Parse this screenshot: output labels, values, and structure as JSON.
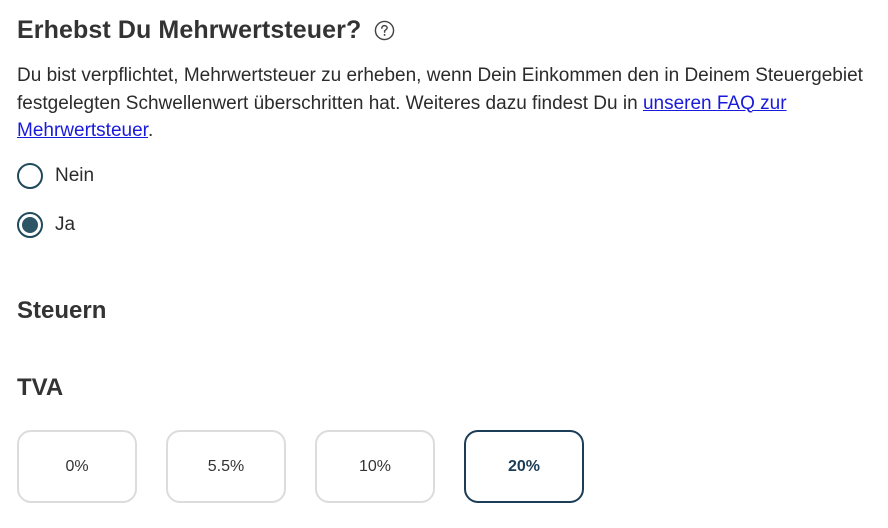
{
  "vat_question": {
    "title": "Erhebst Du Mehrwertsteuer?",
    "help_icon": "question-circle-icon",
    "description_text": "Du bist verpflichtet, Mehrwertsteuer zu erheben, wenn Dein Einkommen den in Deinem Steuergebiet festgelegten Schwellenwert überschritten hat. Weiteres dazu findest Du in ",
    "link_text": "unseren FAQ zur Mehrwertsteuer",
    "description_suffix": ".",
    "options": [
      {
        "label": "Nein",
        "selected": false
      },
      {
        "label": "Ja",
        "selected": true
      }
    ]
  },
  "taxes": {
    "heading": "Steuern"
  },
  "tva": {
    "heading": "TVA",
    "rates": [
      {
        "label": "0%",
        "selected": false
      },
      {
        "label": "5.5%",
        "selected": false
      },
      {
        "label": "10%",
        "selected": false
      },
      {
        "label": "20%",
        "selected": true
      }
    ]
  },
  "colors": {
    "radio_border": "#1f4a5b",
    "radio_fill": "#2c5566",
    "link": "#1a1add",
    "selected_rate_border": "#1c3d57",
    "rate_border": "#dcdcdc"
  }
}
